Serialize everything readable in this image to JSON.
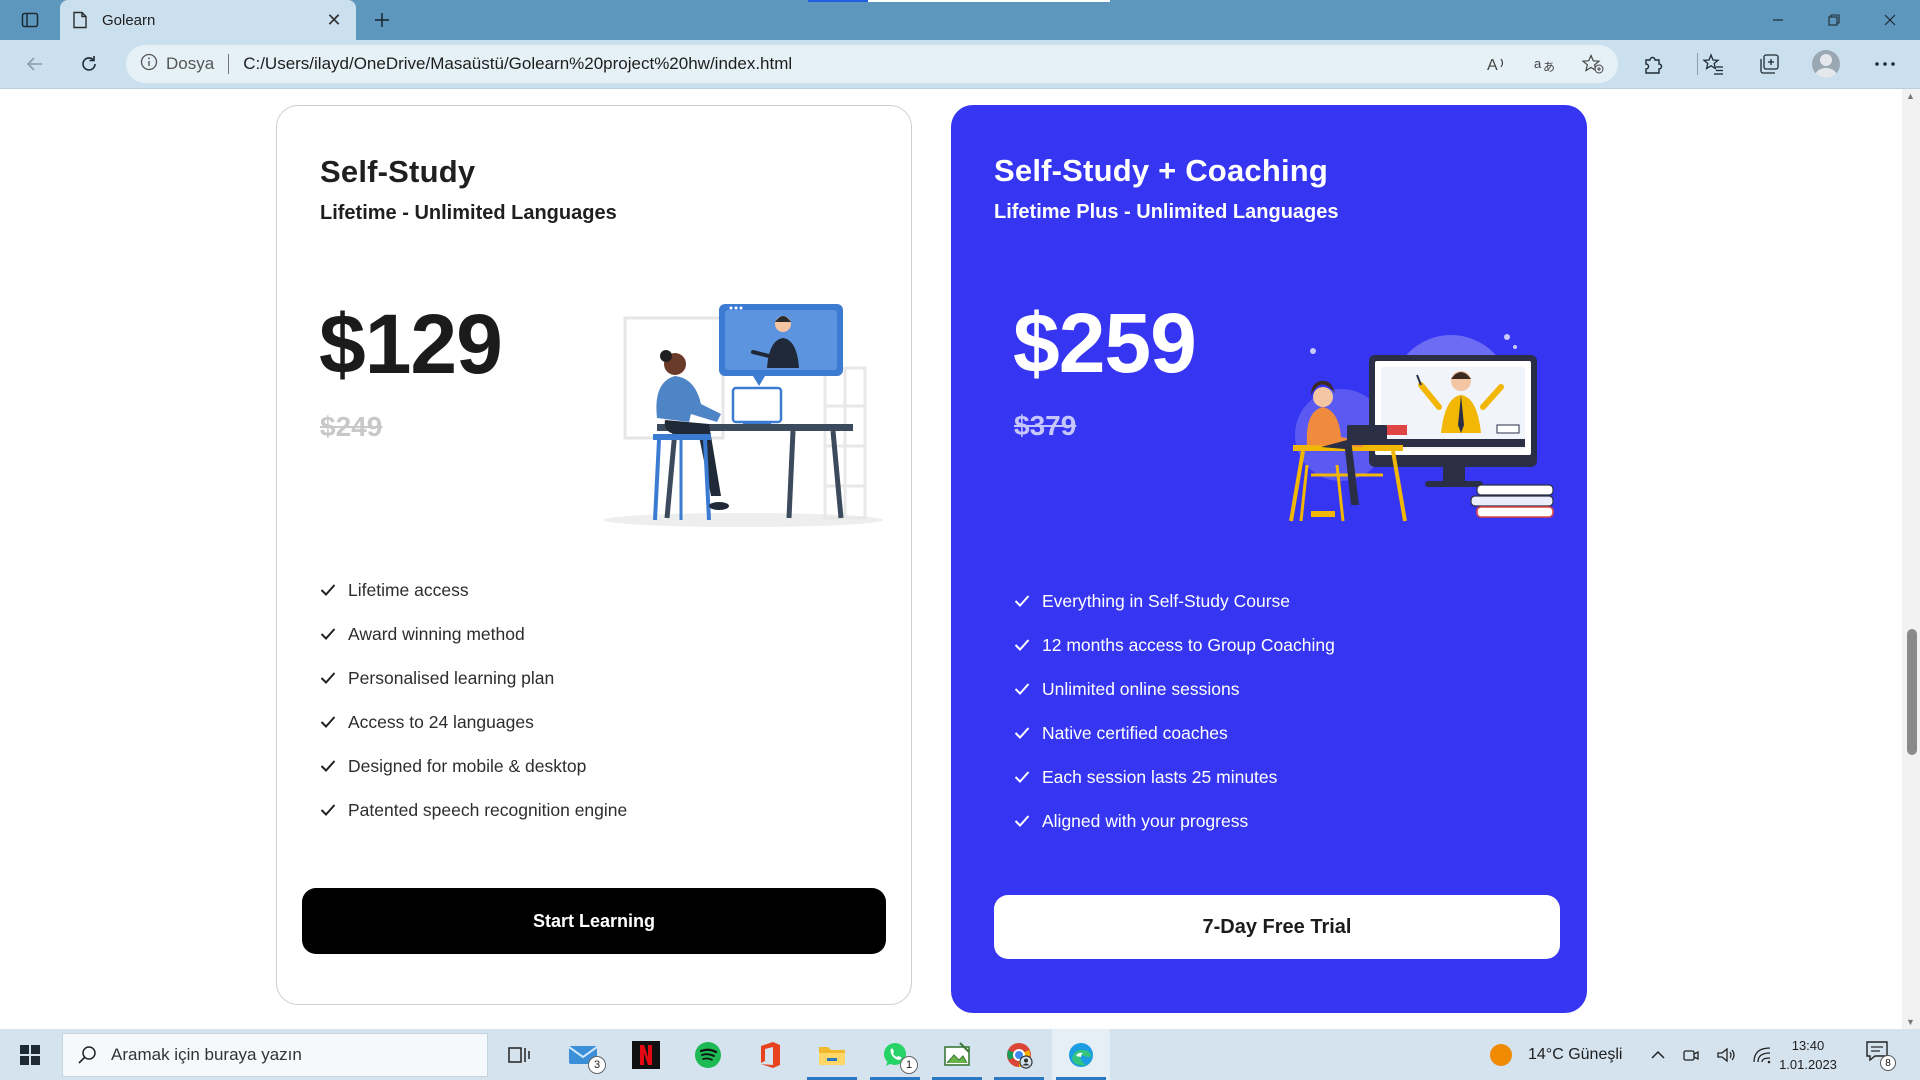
{
  "browser": {
    "tab_title": "Golearn",
    "url_scheme_label": "Dosya",
    "url": "C:/Users/ilayd/OneDrive/Masaüstü/Golearn%20project%20hw/index.html"
  },
  "plans": [
    {
      "name": "Self-Study",
      "subtitle": "Lifetime - Unlimited Languages",
      "price": "$129",
      "old_price": "$249",
      "features": [
        "Lifetime access",
        "Award winning method",
        "Personalised learning plan",
        "Access to 24 languages",
        "Designed for mobile & desktop",
        "Patented speech recognition engine"
      ],
      "cta": "Start Learning"
    },
    {
      "name": "Self-Study + Coaching",
      "subtitle": "Lifetime Plus - Unlimited Languages",
      "price": "$259",
      "old_price": "$379",
      "features": [
        "Everything in Self-Study Course",
        "12 months access to Group Coaching",
        "Unlimited online sessions",
        "Native certified coaches",
        "Each session lasts 25 minutes",
        "Aligned with your progress"
      ],
      "cta": "7-Day Free Trial"
    }
  ],
  "taskbar": {
    "search_placeholder": "Aramak için buraya yazın",
    "mail_badge": "3",
    "whatsapp_badge": "1",
    "weather": "14°C  Güneşli",
    "time": "13:40",
    "date": "1.01.2023",
    "notification_count": "8"
  },
  "colors": {
    "accent": "#3535f2",
    "chrome_tab": "#5e97bd",
    "chrome_bar": "#cbe0ee"
  },
  "icons": {
    "tab_sidebar": "tab-actions-icon",
    "page": "page-icon",
    "close": "close-icon",
    "new_tab": "plus-icon",
    "back": "arrow-left-icon",
    "refresh": "refresh-icon",
    "info": "info-icon",
    "read_aloud": "read-aloud-icon",
    "translate": "translate-icon",
    "favorite_add": "star-plus-icon",
    "extensions": "puzzle-icon",
    "favorites": "favorites-icon",
    "collections": "collections-icon",
    "more": "ellipsis-icon",
    "check": "check-icon"
  }
}
